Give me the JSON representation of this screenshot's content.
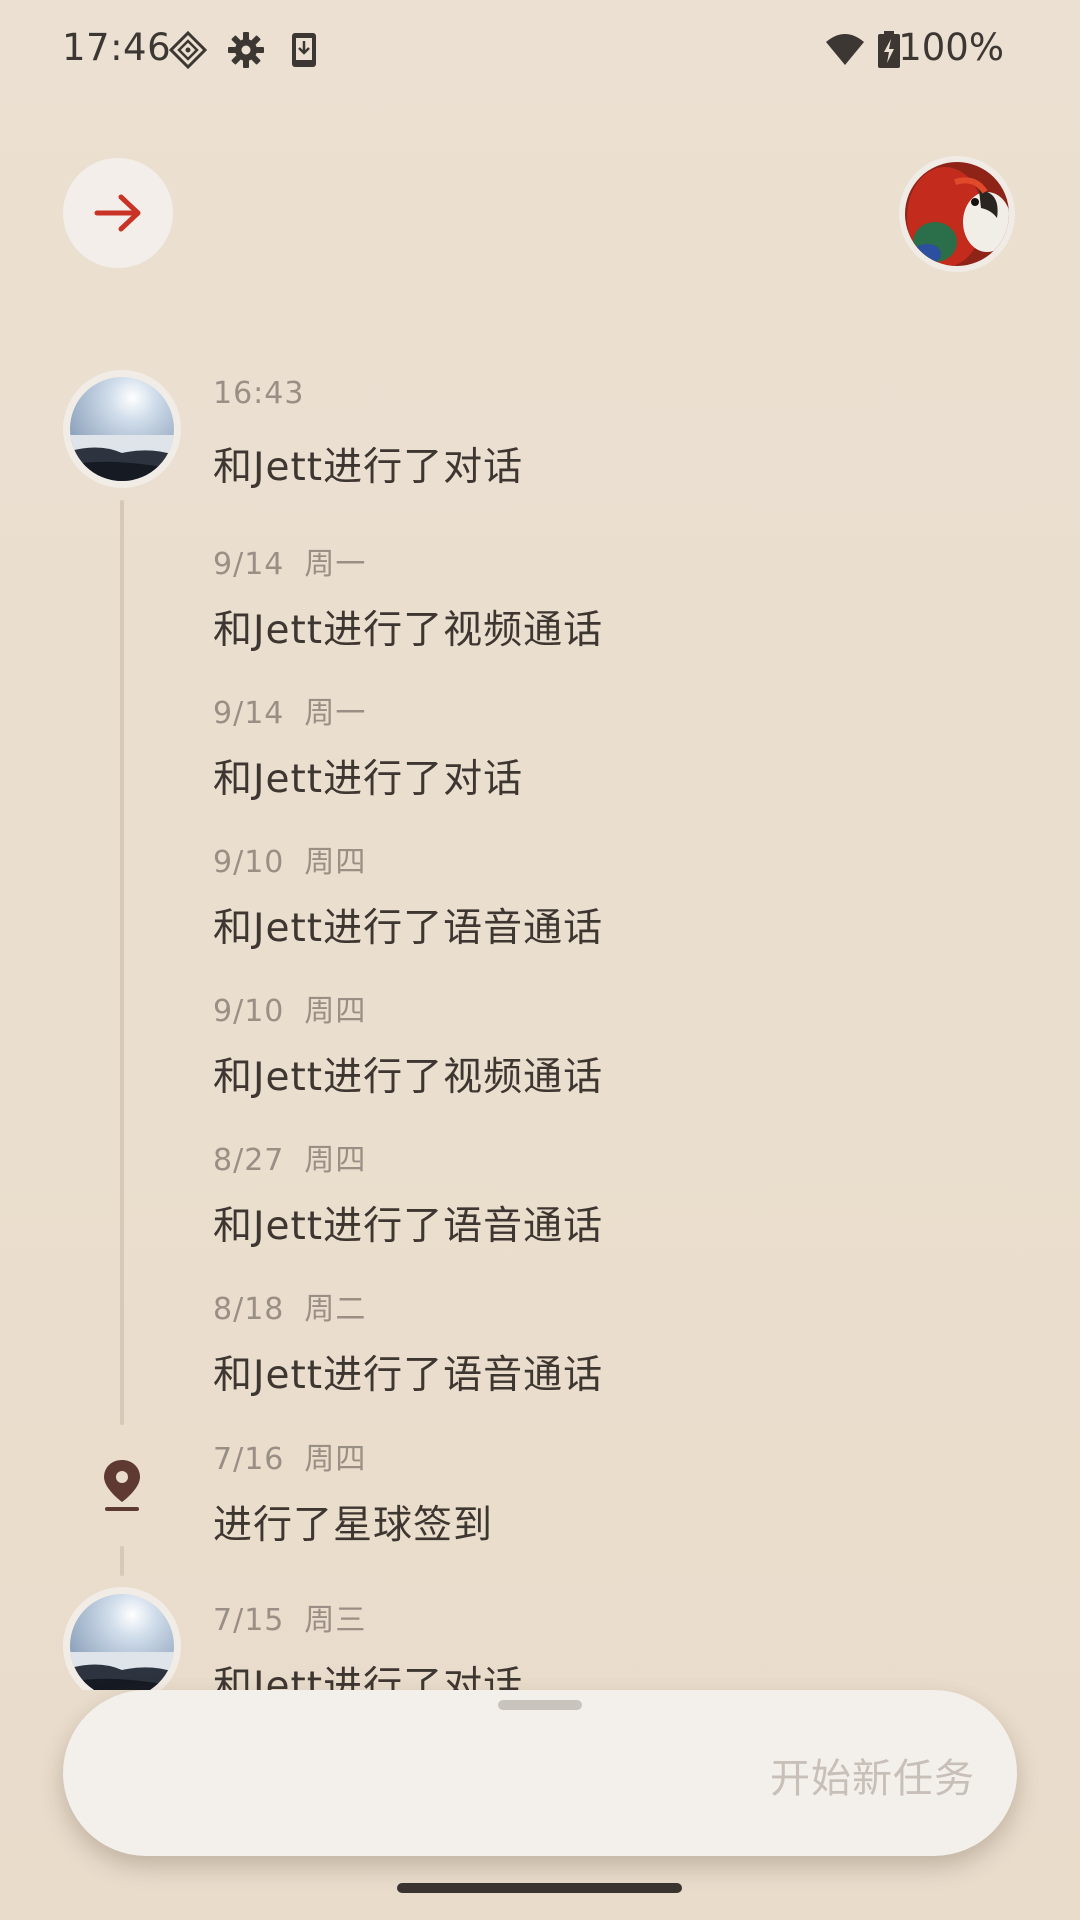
{
  "status_bar": {
    "time": "17:46",
    "battery": "100%",
    "icons": [
      "nfc-diamond-icon",
      "settings-gear-icon",
      "download-phone-icon",
      "wifi-icon",
      "battery-charging-icon"
    ]
  },
  "header": {
    "forward_icon": "arrow-right-icon",
    "accent_color": "#c93325",
    "profile_avatar": "parrot-avatar"
  },
  "timeline": {
    "entries": [
      {
        "date": "16:43",
        "day": "",
        "title": "和Jett进行了对话",
        "marker": "avatar"
      },
      {
        "date": "9/14",
        "day": "周一",
        "title": "和Jett进行了视频通话",
        "marker": "none"
      },
      {
        "date": "9/14",
        "day": "周一",
        "title": "和Jett进行了对话",
        "marker": "none"
      },
      {
        "date": "9/10",
        "day": "周四",
        "title": "和Jett进行了语音通话",
        "marker": "none"
      },
      {
        "date": "9/10",
        "day": "周四",
        "title": "和Jett进行了视频通话",
        "marker": "none"
      },
      {
        "date": "8/27",
        "day": "周四",
        "title": "和Jett进行了语音通话",
        "marker": "none"
      },
      {
        "date": "8/18",
        "day": "周二",
        "title": "和Jett进行了语音通话",
        "marker": "none"
      },
      {
        "date": "7/16",
        "day": "周四",
        "title": "进行了星球签到",
        "marker": "location-pin"
      },
      {
        "date": "7/15",
        "day": "周三",
        "title": "和Jett进行了对话",
        "marker": "avatar"
      }
    ]
  },
  "bottom_sheet": {
    "input_placeholder": "开始新任务"
  }
}
